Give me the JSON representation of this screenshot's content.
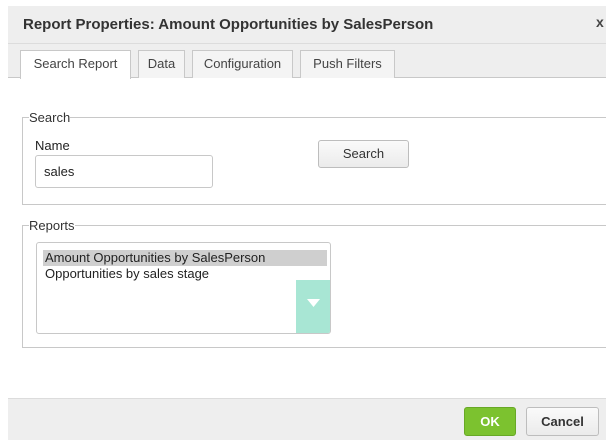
{
  "dialog": {
    "title": "Report Properties: Amount Opportunities by SalesPerson",
    "close_glyph": "x"
  },
  "tabs": [
    {
      "label": "Search Report",
      "active": true
    },
    {
      "label": "Data",
      "active": false
    },
    {
      "label": "Configuration",
      "active": false
    },
    {
      "label": "Push Filters",
      "active": false
    }
  ],
  "search": {
    "legend": "Search",
    "name_label": "Name",
    "name_value": "sales",
    "button_label": "Search"
  },
  "reports": {
    "legend": "Reports",
    "items": [
      {
        "label": "Amount Opportunities by SalesPerson",
        "selected": true
      },
      {
        "label": "Opportunities by sales stage",
        "selected": false
      }
    ],
    "scroll_icon": "chevron-down-icon",
    "scroll_color": "#a8e6d4"
  },
  "footer": {
    "ok_label": "OK",
    "cancel_label": "Cancel",
    "ok_color": "#7cc22f"
  }
}
